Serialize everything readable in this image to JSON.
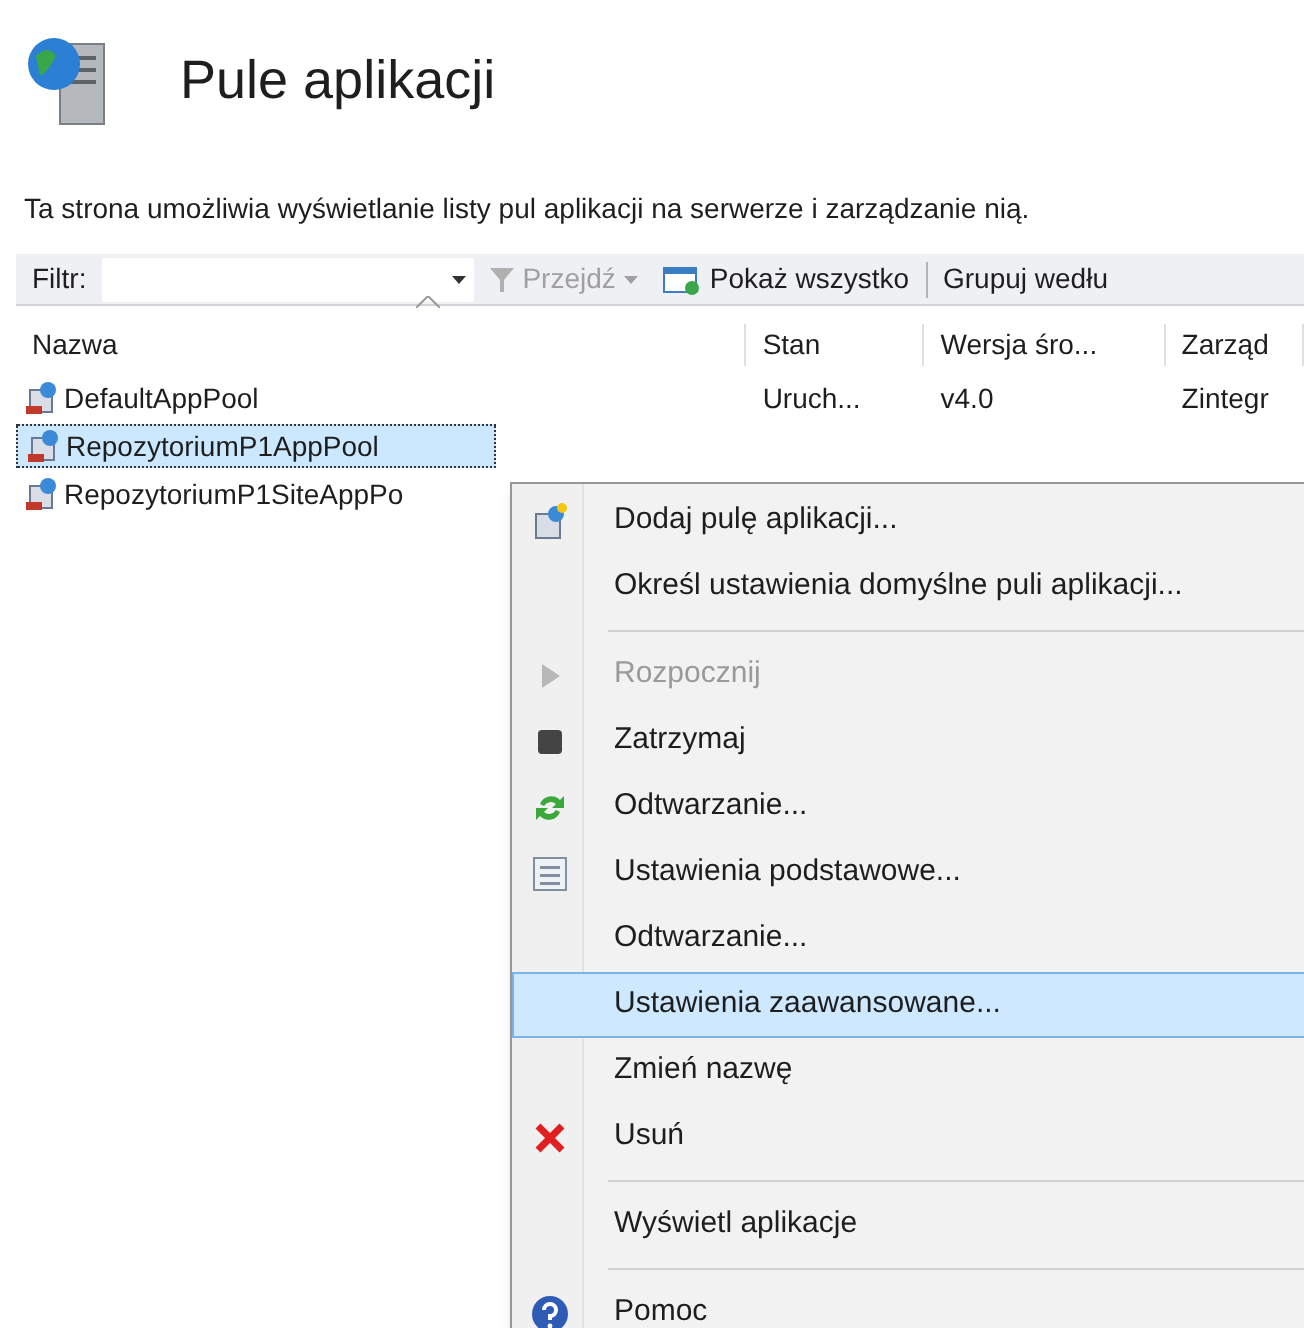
{
  "header": {
    "title": "Pule aplikacji"
  },
  "description": "Ta strona umożliwia wyświetlanie listy pul aplikacji na serwerze i zarządzanie nią.",
  "toolbar": {
    "filter_label": "Filtr:",
    "go": {
      "label": "Przejdź",
      "disabled": true
    },
    "show_all": "Pokaż wszystko",
    "group_by": "Grupuj wedłu"
  },
  "table": {
    "columns": [
      "Nazwa",
      "Stan",
      "Wersja śro...",
      "Zarząd"
    ],
    "rows": [
      {
        "cells": [
          "DefaultAppPool",
          "Uruch...",
          "v4.0",
          "Zintegr"
        ],
        "selected": false
      },
      {
        "cells": [
          "RepozytoriumP1AppPool"
        ],
        "selected": true
      },
      {
        "cells": [
          "RepozytoriumP1SiteAppPo"
        ],
        "selected": false
      }
    ]
  },
  "context_menu": [
    {
      "kind": "add",
      "label": "Dodaj pulę aplikacji...",
      "disabled": false,
      "selected": false
    },
    {
      "kind": "plain",
      "label": "Określ ustawienia domyślne puli aplikacji...",
      "disabled": false,
      "selected": false
    },
    {
      "kind": "separator"
    },
    {
      "kind": "play",
      "label": "Rozpocznij",
      "disabled": true,
      "selected": false
    },
    {
      "kind": "stop",
      "label": "Zatrzymaj",
      "disabled": false,
      "selected": false
    },
    {
      "kind": "recycle",
      "label": "Odtwarzanie...",
      "disabled": false,
      "selected": false
    },
    {
      "kind": "settings",
      "label": "Ustawienia podstawowe...",
      "disabled": false,
      "selected": false
    },
    {
      "kind": "plain",
      "label": "Odtwarzanie...",
      "disabled": false,
      "selected": false
    },
    {
      "kind": "plain",
      "label": "Ustawienia zaawansowane...",
      "disabled": false,
      "selected": true
    },
    {
      "kind": "plain",
      "label": "Zmień nazwę",
      "disabled": false,
      "selected": false
    },
    {
      "kind": "delete",
      "label": "Usuń",
      "disabled": false,
      "selected": false
    },
    {
      "kind": "separator"
    },
    {
      "kind": "plain",
      "label": "Wyświetl aplikacje",
      "disabled": false,
      "selected": false
    },
    {
      "kind": "separator"
    },
    {
      "kind": "help",
      "label": "Pomoc",
      "disabled": false,
      "selected": false
    }
  ]
}
